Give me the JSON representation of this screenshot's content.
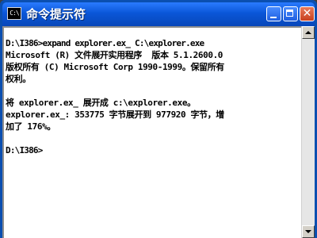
{
  "window": {
    "title": "命令提示符",
    "icon_label": "C:\\",
    "controls": {
      "minimize": "minimize-icon",
      "maximize": "maximize-icon",
      "close": "close-icon"
    },
    "colors": {
      "titlebar": "#0a56d8",
      "console_bg": "#ffffff",
      "console_text": "#000000"
    }
  },
  "console": {
    "lines": [
      "D:\\I386>expand explorer.ex_ C:\\explorer.exe",
      "Microsoft (R) 文件展开实用程序  版本 5.1.2600.0",
      "版权所有 (C) Microsoft Corp 1990-1999。保留所有",
      "权利。",
      "将 explorer.ex_ 展开成 c:\\explorer.exe。",
      "explorer.ex_: 353775 字节展开到 977920 字节，增",
      "加了 176%。",
      "D:\\I386>"
    ]
  },
  "scrollbar": {
    "up": "scroll-up-arrow-icon",
    "down": "scroll-down-arrow-icon"
  }
}
